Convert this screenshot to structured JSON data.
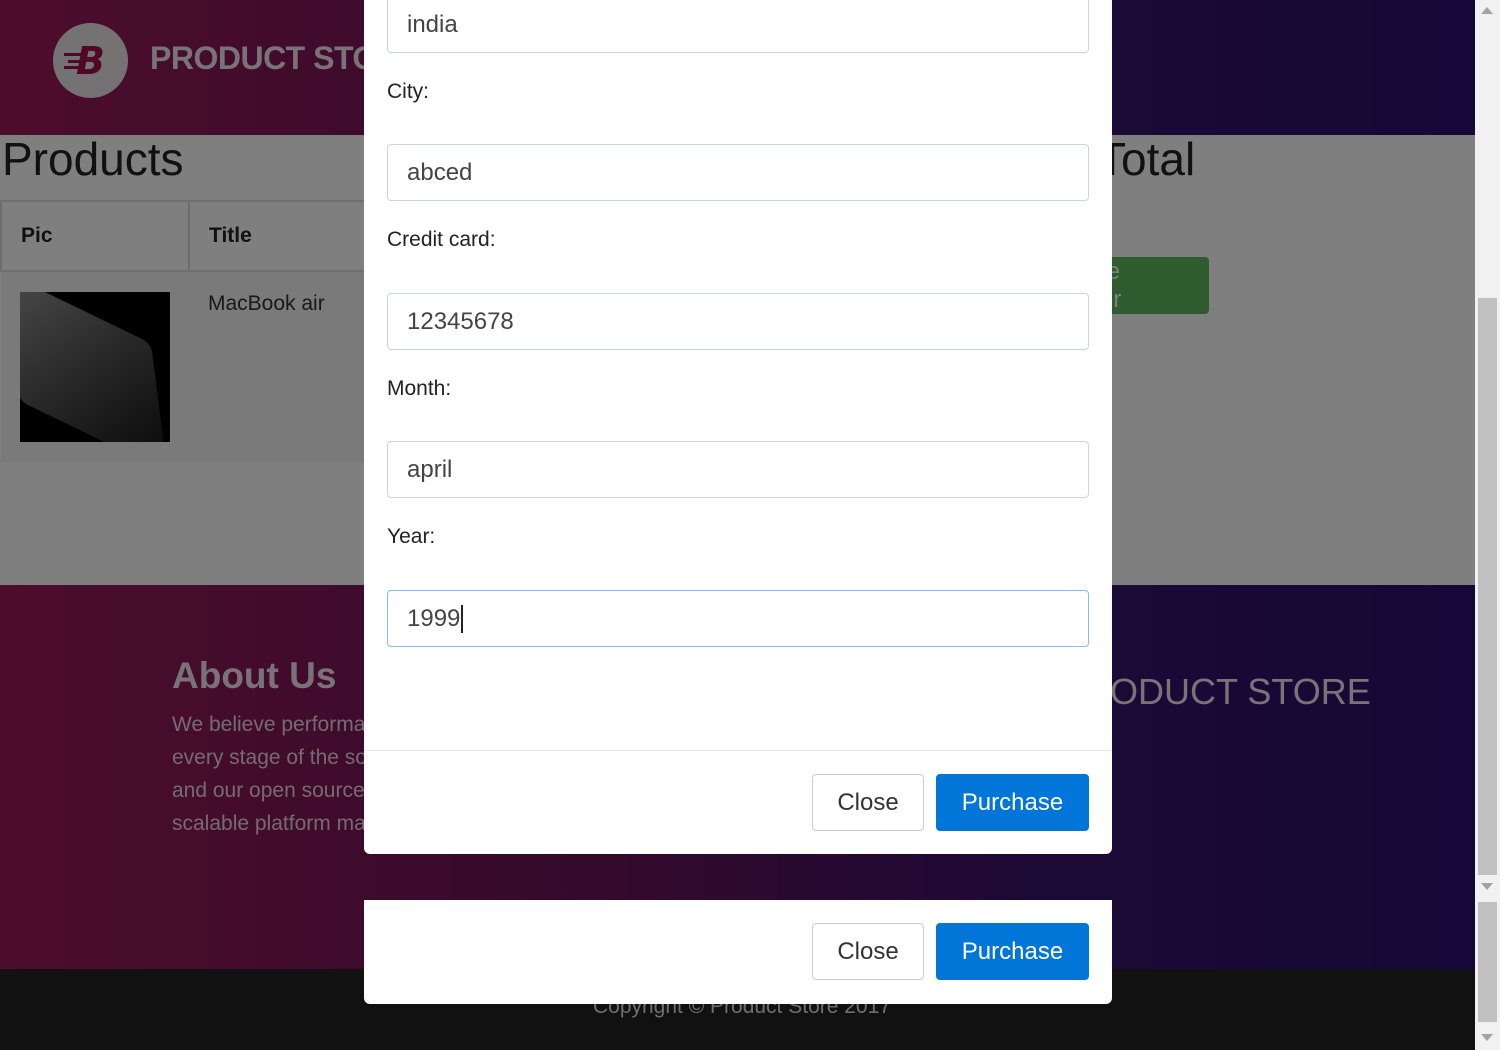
{
  "navbar": {
    "brand": "PRODUCT STORE",
    "logo_letter": "B"
  },
  "products": {
    "title": "Products",
    "total_title": "Total",
    "columns": [
      "Pic",
      "Title"
    ],
    "rows": [
      {
        "title": "MacBook air"
      }
    ],
    "place_order_label": "Place Order"
  },
  "footer": {
    "about_title": "About Us",
    "about_text": "We believe performance needs to be validated at every stage of the software development cycle and our open source compatible, massively scalable platform makes that a reality.",
    "brand": "PRODUCT STORE",
    "copyright": "Copyright © Product Store 2017"
  },
  "modal": {
    "country_value": "india",
    "city_label": "City:",
    "city_value": "abced",
    "card_label": "Credit card:",
    "card_value": "12345678",
    "month_label": "Month:",
    "month_value": "april",
    "year_label": "Year:",
    "year_value": "1999",
    "close_label": "Close",
    "purchase_label": "Purchase"
  }
}
